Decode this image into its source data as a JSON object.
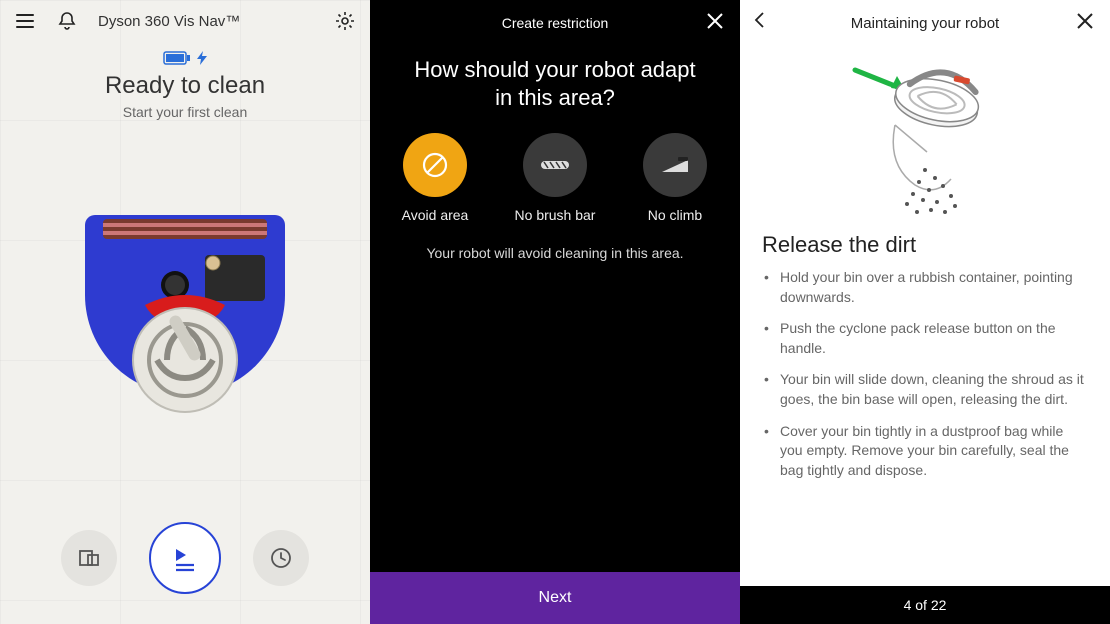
{
  "panel1": {
    "device_name": "Dyson 360 Vis Nav™",
    "status_title": "Ready to clean",
    "status_sub": "Start your first clean"
  },
  "panel2": {
    "header_title": "Create restriction",
    "question": "How should your robot adapt in this area?",
    "options": {
      "avoid": "Avoid area",
      "no_brush": "No brush bar",
      "no_climb": "No climb"
    },
    "helper": "Your robot will avoid cleaning in this area.",
    "next_label": "Next"
  },
  "panel3": {
    "header_title": "Maintaining your robot",
    "section_title": "Release the dirt",
    "bullets": [
      "Hold your bin over a rubbish container, pointing downwards.",
      "Push the cyclone pack release button on the handle.",
      "Your bin will slide down, cleaning the shroud as it goes, the bin base will open, releasing the dirt.",
      "Cover your bin tightly in a dustproof bag while you empty. Remove your bin carefully, seal the bag tightly and dispose."
    ],
    "pager": "4  of  22"
  }
}
